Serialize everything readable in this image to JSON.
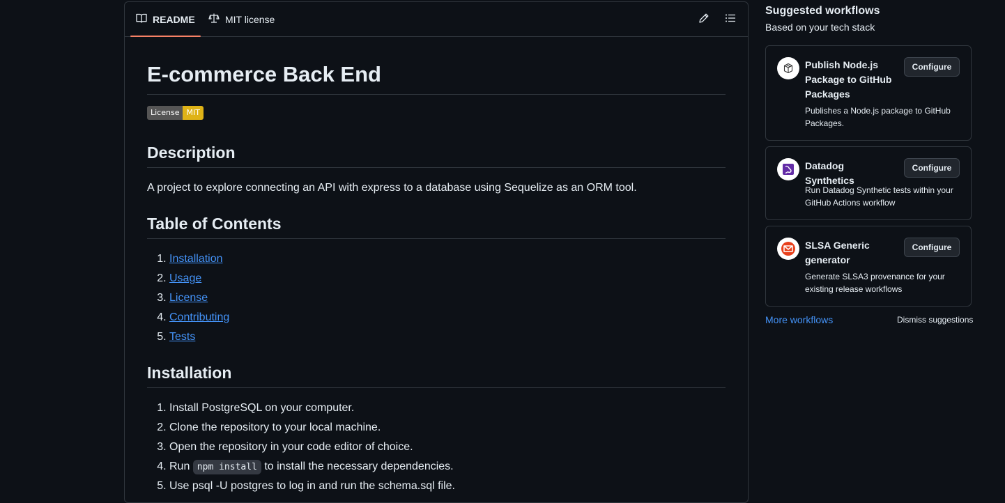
{
  "readme_header": {
    "tabs": [
      {
        "label": "README",
        "icon": "book-icon"
      },
      {
        "label": "MIT license",
        "icon": "scale-icon"
      }
    ],
    "edit_icon": "pencil-icon",
    "toc_icon": "list-unordered-icon"
  },
  "readme": {
    "title": "E-commerce Back End",
    "badge": {
      "left": "License",
      "right": "MIT",
      "right_color": "#dfb317"
    },
    "description_heading": "Description",
    "description": "A project to explore connecting an API with express to a database using Sequelize as an ORM tool.",
    "toc_heading": "Table of Contents",
    "toc": [
      "Installation",
      "Usage",
      "License",
      "Contributing",
      "Tests"
    ],
    "installation_heading": "Installation",
    "installation_steps": {
      "s1": "Install PostgreSQL on your computer.",
      "s2": "Clone the repository to your local machine.",
      "s3": "Open the repository in your code editor of choice.",
      "s4_before": "Run ",
      "s4_code": "npm install",
      "s4_after": " to install the necessary dependencies.",
      "s5": "Use psql -U postgres to log in and run the schema.sql file."
    }
  },
  "sidebar": {
    "title": "Suggested workflows",
    "subtitle": "Based on your tech stack",
    "workflows": [
      {
        "name": "Publish Node.js Package to GitHub Packages",
        "description": "Publishes a Node.js package to GitHub Packages.",
        "button": "Configure",
        "icon": "package-icon"
      },
      {
        "name": "Datadog Synthetics",
        "description": "Run Datadog Synthetic tests within your GitHub Actions workflow",
        "button": "Configure",
        "icon": "datadog-icon"
      },
      {
        "name": "SLSA Generic generator",
        "description": "Generate SLSA3 provenance for your existing release workflows",
        "button": "Configure",
        "icon": "slsa-icon"
      }
    ],
    "more_workflows": "More workflows",
    "dismiss": "Dismiss suggestions"
  },
  "colors": {
    "accent_link": "#4493f8",
    "tab_underline": "#f78166",
    "background": "#0d1117"
  }
}
